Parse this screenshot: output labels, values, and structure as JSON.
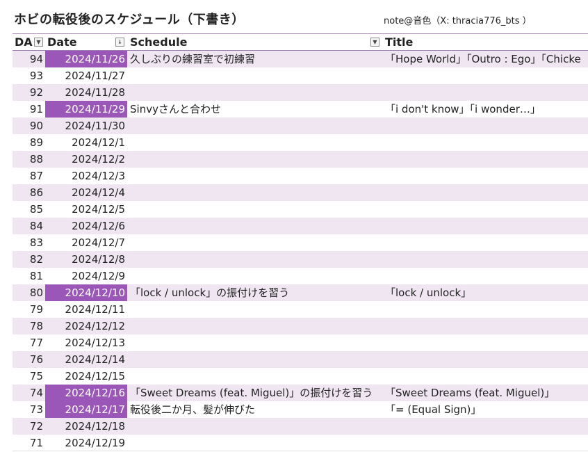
{
  "page": {
    "title": "ホビの転役後のスケジュール（下書き）",
    "credit": "note@音色（X: thracia776_bts ）"
  },
  "columns": {
    "day": "DA",
    "date": "Date",
    "schedule": "Schedule",
    "title": "Title"
  },
  "icons": {
    "day_filter": "dropdown-arrow-icon",
    "date_filter": "sort-filter-icon",
    "schedule_filter": "dropdown-arrow-icon"
  },
  "colors": {
    "highlight": "#9b57b8",
    "band": "#efe6f2"
  },
  "rows": [
    {
      "day": "94",
      "date": "2024/11/26",
      "schedule": "久しぶりの練習室で初練習",
      "title": "「Hope World」「Outro : Ego」「Chicke",
      "highlight": true
    },
    {
      "day": "93",
      "date": "2024/11/27",
      "schedule": "",
      "title": "",
      "highlight": false
    },
    {
      "day": "92",
      "date": "2024/11/28",
      "schedule": "",
      "title": "",
      "highlight": false
    },
    {
      "day": "91",
      "date": "2024/11/29",
      "schedule": "Sinvyさんと合わせ",
      "title": "「i don't know」「i wonder…」",
      "highlight": true
    },
    {
      "day": "90",
      "date": "2024/11/30",
      "schedule": "",
      "title": "",
      "highlight": false
    },
    {
      "day": "89",
      "date": "2024/12/1",
      "schedule": "",
      "title": "",
      "highlight": false
    },
    {
      "day": "88",
      "date": "2024/12/2",
      "schedule": "",
      "title": "",
      "highlight": false
    },
    {
      "day": "87",
      "date": "2024/12/3",
      "schedule": "",
      "title": "",
      "highlight": false
    },
    {
      "day": "86",
      "date": "2024/12/4",
      "schedule": "",
      "title": "",
      "highlight": false
    },
    {
      "day": "85",
      "date": "2024/12/5",
      "schedule": "",
      "title": "",
      "highlight": false
    },
    {
      "day": "84",
      "date": "2024/12/6",
      "schedule": "",
      "title": "",
      "highlight": false
    },
    {
      "day": "83",
      "date": "2024/12/7",
      "schedule": "",
      "title": "",
      "highlight": false
    },
    {
      "day": "82",
      "date": "2024/12/8",
      "schedule": "",
      "title": "",
      "highlight": false
    },
    {
      "day": "81",
      "date": "2024/12/9",
      "schedule": "",
      "title": "",
      "highlight": false
    },
    {
      "day": "80",
      "date": "2024/12/10",
      "schedule": "「lock / unlock」の振付けを習う",
      "title": "「lock / unlock」",
      "highlight": true
    },
    {
      "day": "79",
      "date": "2024/12/11",
      "schedule": "",
      "title": "",
      "highlight": false
    },
    {
      "day": "78",
      "date": "2024/12/12",
      "schedule": "",
      "title": "",
      "highlight": false
    },
    {
      "day": "77",
      "date": "2024/12/13",
      "schedule": "",
      "title": "",
      "highlight": false
    },
    {
      "day": "76",
      "date": "2024/12/14",
      "schedule": "",
      "title": "",
      "highlight": false
    },
    {
      "day": "75",
      "date": "2024/12/15",
      "schedule": "",
      "title": "",
      "highlight": false
    },
    {
      "day": "74",
      "date": "2024/12/16",
      "schedule": "「Sweet Dreams (feat. Miguel)」の振付けを習う",
      "title": "「Sweet Dreams (feat. Miguel)」",
      "highlight": true
    },
    {
      "day": "73",
      "date": "2024/12/17",
      "schedule": "転役後二か月、髪が伸びた",
      "title": "「= (Equal Sign)」",
      "highlight": true
    },
    {
      "day": "72",
      "date": "2024/12/18",
      "schedule": "",
      "title": "",
      "highlight": false
    },
    {
      "day": "71",
      "date": "2024/12/19",
      "schedule": "",
      "title": "",
      "highlight": false
    }
  ]
}
